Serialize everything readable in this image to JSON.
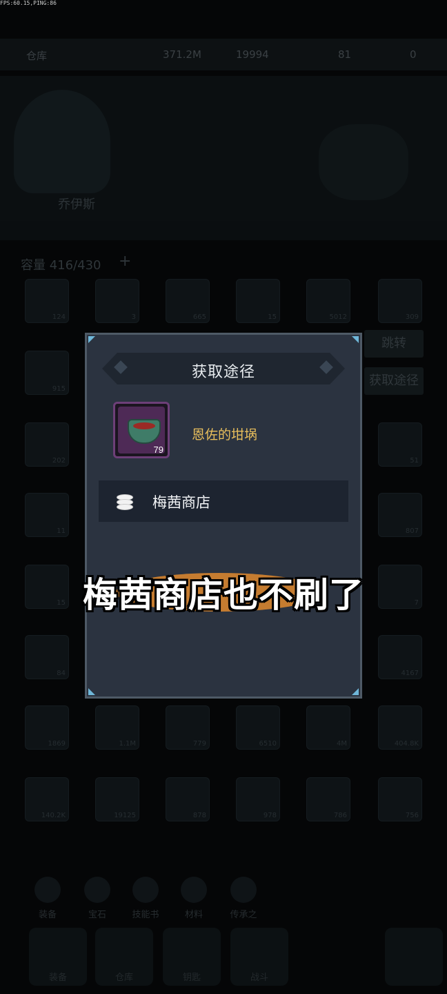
{
  "debug": {
    "fps_text": "FPS:60.15,PING:86"
  },
  "background": {
    "title": "仓库",
    "resources": [
      "371.2M",
      "19994",
      "81",
      "0"
    ],
    "character_name": "乔伊斯",
    "capacity_label": "容量",
    "capacity_value": "416/430",
    "side_buttons": [
      "跳转",
      "获取途径"
    ],
    "cell_counts": [
      "124",
      "3",
      "665",
      "15",
      "5012",
      "309",
      "915",
      "202",
      "51",
      "11",
      "807",
      "15",
      "7",
      "84",
      "4167",
      "1869",
      "1.1M",
      "779",
      "6510",
      "4M",
      "404.8K",
      "140.2K",
      "19125",
      "878",
      "978",
      "786",
      "756"
    ],
    "bottom_tabs": [
      "装备",
      "宝石",
      "技能书",
      "材料",
      "传承之"
    ],
    "nav_labels": [
      "装备",
      "仓库",
      "钥匙",
      "战斗"
    ]
  },
  "dialog": {
    "title": "获取途径",
    "item": {
      "name": "恩佐的坩埚",
      "count": "79",
      "icon": "crucible-icon"
    },
    "sources": [
      {
        "label": "梅茜商店",
        "icon": "coin-stack-icon"
      }
    ]
  },
  "subtitle": "梅茜商店也不刷了",
  "colors": {
    "accent_gold": "#e9bf5c",
    "dialog_bg": "#2b3340",
    "rarity_purple": "#6d3f78",
    "swoosh": "#e08a2e"
  }
}
